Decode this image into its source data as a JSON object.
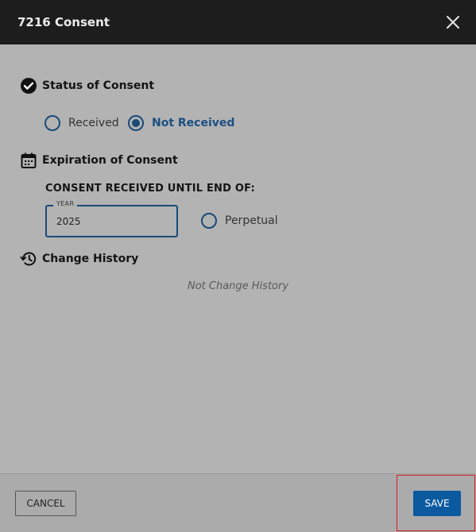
{
  "dialog": {
    "title": "7216 Consent",
    "close_icon": "close-icon"
  },
  "status_section": {
    "icon": "check-circle-icon",
    "heading": "Status of Consent",
    "options": [
      {
        "label": "Received",
        "selected": false
      },
      {
        "label": "Not Received",
        "selected": true
      }
    ]
  },
  "expiration_section": {
    "icon": "calendar-icon",
    "heading": "Expiration of Consent",
    "until_label": "CONSENT RECEIVED UNTIL END OF:",
    "year_field": {
      "label": "YEAR",
      "value": "2025"
    },
    "perpetual": {
      "label": "Perpetual",
      "selected": false
    }
  },
  "history_section": {
    "icon": "history-icon",
    "heading": "Change History",
    "empty_text": "Not Change History"
  },
  "footer": {
    "cancel_label": "CANCEL",
    "save_label": "SAVE"
  },
  "colors": {
    "header_bg": "#1d1d1d",
    "body_bg": "#b3b3b3",
    "accent": "#1a4a78",
    "save_bg": "#0b5aa0",
    "highlight": "#d21f1f"
  }
}
